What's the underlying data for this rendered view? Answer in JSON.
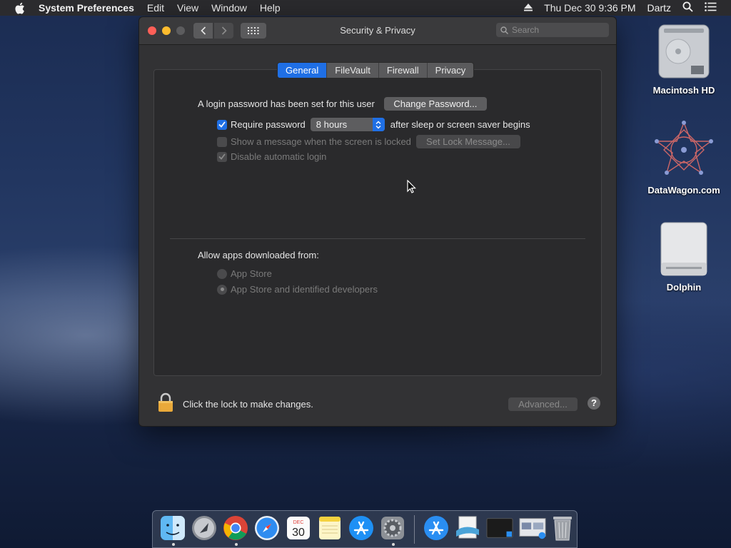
{
  "menubar": {
    "app_name": "System Preferences",
    "items": [
      "Edit",
      "View",
      "Window",
      "Help"
    ],
    "clock": "Thu Dec 30  9:36 PM",
    "user": "Dartz"
  },
  "desktop": {
    "icons": [
      {
        "label": "Macintosh HD",
        "icon": "hard-drive-icon"
      },
      {
        "label": "DataWagon.com",
        "icon": "datawagon-icon"
      },
      {
        "label": "Dolphin",
        "icon": "external-drive-icon"
      }
    ]
  },
  "window": {
    "title": "Security & Privacy",
    "search_placeholder": "Search",
    "tabs": [
      {
        "label": "General",
        "active": true
      },
      {
        "label": "FileVault",
        "active": false
      },
      {
        "label": "Firewall",
        "active": false
      },
      {
        "label": "Privacy",
        "active": false
      }
    ],
    "general": {
      "login_text": "A login password has been set for this user",
      "change_password_label": "Change Password...",
      "require_password_label": "Require password",
      "require_password_value": "8 hours",
      "require_password_suffix": "after sleep or screen saver begins",
      "show_message_label": "Show a message when the screen is locked",
      "set_lock_message_label": "Set Lock Message...",
      "disable_auto_login_label": "Disable automatic login",
      "allow_apps_label": "Allow apps downloaded from:",
      "radio_app_store": "App Store",
      "radio_app_store_identified": "App Store and identified developers"
    },
    "footer": {
      "lock_text": "Click the lock to make changes.",
      "advanced_label": "Advanced...",
      "help_label": "?"
    }
  },
  "dock": {
    "calendar_month": "DEC",
    "calendar_day": "30",
    "apps": [
      "finder-icon",
      "launchpad-icon",
      "chrome-icon",
      "safari-icon",
      "calendar-icon",
      "notes-icon",
      "app-store-icon",
      "system-preferences-icon",
      "app-store-download-icon",
      "preview-icon",
      "terminal-icon",
      "downloads-stack-icon",
      "trash-icon"
    ]
  },
  "colors": {
    "accent": "#1f6fe5",
    "window_bg": "#323234",
    "close": "#fe5f57",
    "minimize": "#febc2e"
  }
}
